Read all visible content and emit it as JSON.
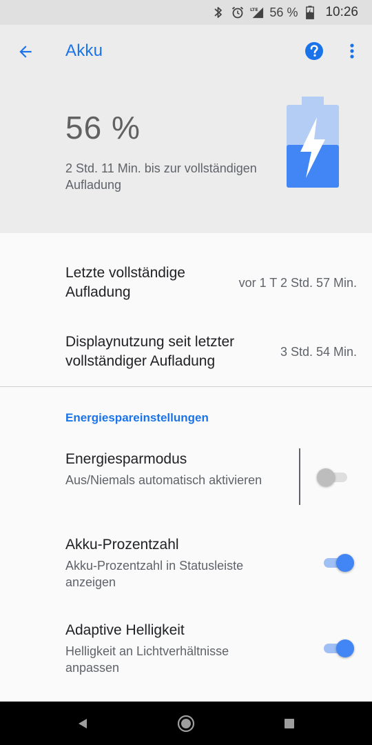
{
  "status_bar": {
    "battery_percent": "56 %",
    "time": "10:26",
    "icons": [
      "bluetooth-icon",
      "alarm-icon",
      "lte-signal-icon",
      "battery-charging-icon"
    ]
  },
  "app_bar": {
    "title": "Akku",
    "back_icon": "arrow-back-icon",
    "help_icon": "help-circle-icon",
    "more_icon": "more-vert-icon",
    "accent_color": "#1a73e8"
  },
  "battery": {
    "percent_text": "56 %",
    "level": 0.56,
    "charge_time_text": "2 Std. 11 Min. bis zur vollständigen Aufladung",
    "graphic_color": "#4285f4",
    "graphic_color_light": "#b3cdf5",
    "icon": "battery-charging-icon"
  },
  "usage": {
    "last_charge_label": "Letzte vollständige Aufladung",
    "last_charge_value": "vor 1 T 2 Std. 57 Min.",
    "screen_usage_label": "Displaynutzung seit letzter vollständiger Aufladung",
    "screen_usage_value": "3 Std. 54 Min."
  },
  "power_saving": {
    "section_title": "Energiespareinstellungen",
    "settings": [
      {
        "title": "Energiesparmodus",
        "subtitle": "Aus/Niemals automatisch aktivieren",
        "enabled": false
      },
      {
        "title": "Akku-Prozentzahl",
        "subtitle": "Akku-Prozentzahl in Statusleiste anzeigen",
        "enabled": true
      },
      {
        "title": "Adaptive Helligkeit",
        "subtitle": "Helligkeit an Lichtverhältnisse anpassen",
        "enabled": true
      }
    ]
  },
  "nav_bar": {
    "back_icon": "nav-back-icon",
    "home_icon": "nav-home-icon",
    "recents_icon": "nav-recents-icon"
  }
}
